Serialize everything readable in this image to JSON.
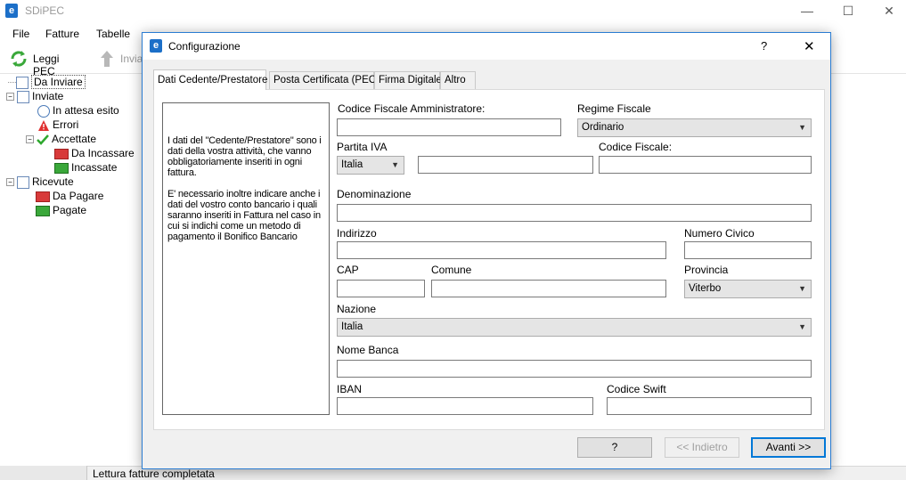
{
  "app": {
    "title": "SDiPEC",
    "minimize": "—",
    "maximize": "☐",
    "close": "✕"
  },
  "menu": [
    "File",
    "Fatture",
    "Tabelle"
  ],
  "toolbar": {
    "read_pec": "Leggi PEC",
    "send": "Invia"
  },
  "tree": [
    {
      "label": "Da Inviare"
    },
    {
      "label": "Inviate"
    },
    {
      "label": "In attesa esito"
    },
    {
      "label": "Errori"
    },
    {
      "label": "Accettate"
    },
    {
      "label": "Da Incassare"
    },
    {
      "label": "Incassate"
    },
    {
      "label": "Ricevute"
    },
    {
      "label": "Da Pagare"
    },
    {
      "label": "Pagate"
    }
  ],
  "statusbar": {
    "text": "Lettura fatture completata"
  },
  "dialog": {
    "title": "Configurazione",
    "help": "?",
    "close": "✕",
    "tabs": [
      "Dati Cedente/Prestatore",
      "Posta Certificata (PEC)",
      "Firma Digitale",
      "Altro"
    ],
    "info_p1": "I dati del \"Cedente/Prestatore\" sono i dati della vostra attività, che vanno obbligatoriamente inseriti in ogni fattura.",
    "info_p2": "E' necessario inoltre indicare anche i dati del vostro conto bancario i quali saranno inseriti in Fattura nel caso in cui si indichi come un metodo di pagamento il Bonifico Bancario",
    "labels": {
      "cf_admin": "Codice Fiscale Amministratore:",
      "regime": "Regime Fiscale",
      "piva": "Partita IVA",
      "cf": "Codice Fiscale:",
      "denominazione": "Denominazione",
      "indirizzo": "Indirizzo",
      "civico": "Numero Civico",
      "cap": "CAP",
      "comune": "Comune",
      "provincia": "Provincia",
      "nazione": "Nazione",
      "banca": "Nome Banca",
      "iban": "IBAN",
      "swift": "Codice Swift"
    },
    "values": {
      "regime": "Ordinario",
      "piva_country": "Italia",
      "provincia": "Viterbo",
      "nazione": "Italia"
    },
    "buttons": {
      "help": "?",
      "back": "<< Indietro",
      "next": "Avanti >>"
    }
  }
}
